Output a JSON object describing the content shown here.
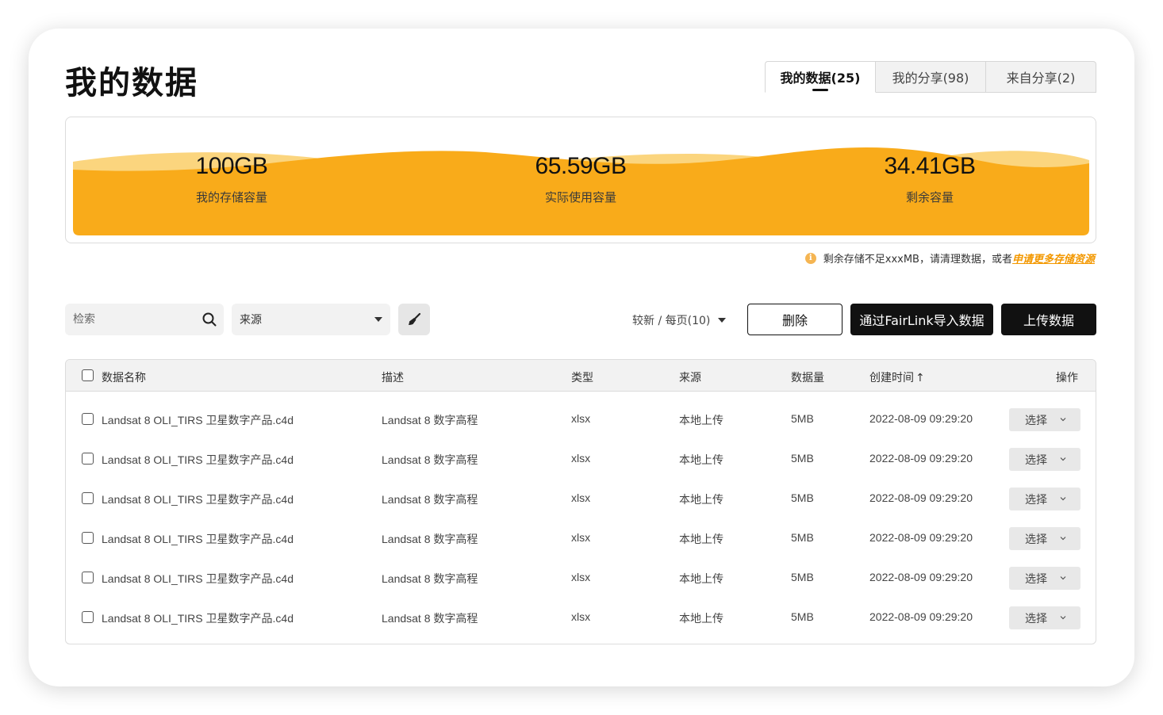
{
  "page_title": "我的数据",
  "tabs": [
    {
      "label": "我的数据(25)",
      "active": true
    },
    {
      "label": "我的分享(98)",
      "active": false
    },
    {
      "label": "来自分享(2)",
      "active": false
    }
  ],
  "storage": {
    "total": {
      "value": "100GB",
      "label": "我的存储容量"
    },
    "used": {
      "value": "65.59GB",
      "label": "实际使用容量"
    },
    "remaining": {
      "value": "34.41GB",
      "label": "剩余容量"
    },
    "colors": {
      "wave_main": "#f9ab1a",
      "wave_light": "#fbd57e"
    }
  },
  "notice": {
    "icon": "info-icon",
    "text": "剩余存储不足xxxMB，请清理数据，或者",
    "link": "申请更多存储资源"
  },
  "toolbar": {
    "search_placeholder": "检索",
    "source_select": "来源",
    "sort_label": "较新 / 每页(10)",
    "delete_label": "删除",
    "import_label": "通过FairLink导入数据",
    "upload_label": "上传数据"
  },
  "table": {
    "headers": {
      "name": "数据名称",
      "desc": "描述",
      "type": "类型",
      "source": "来源",
      "size": "数据量",
      "time": "创建时间",
      "op": "操作"
    },
    "op_select_label": "选择",
    "rows": [
      {
        "name": "Landsat 8 OLI_TIRS 卫星数字产品.c4d",
        "desc": "Landsat 8 数字高程",
        "type": "xlsx",
        "source": "本地上传",
        "size": "5MB",
        "time": "2022-08-09 09:29:20"
      },
      {
        "name": "Landsat 8 OLI_TIRS 卫星数字产品.c4d",
        "desc": "Landsat 8 数字高程",
        "type": "xlsx",
        "source": "本地上传",
        "size": "5MB",
        "time": "2022-08-09 09:29:20"
      },
      {
        "name": "Landsat 8 OLI_TIRS 卫星数字产品.c4d",
        "desc": "Landsat 8 数字高程",
        "type": "xlsx",
        "source": "本地上传",
        "size": "5MB",
        "time": "2022-08-09 09:29:20"
      },
      {
        "name": "Landsat 8 OLI_TIRS 卫星数字产品.c4d",
        "desc": "Landsat 8 数字高程",
        "type": "xlsx",
        "source": "本地上传",
        "size": "5MB",
        "time": "2022-08-09 09:29:20"
      },
      {
        "name": "Landsat 8 OLI_TIRS 卫星数字产品.c4d",
        "desc": "Landsat 8 数字高程",
        "type": "xlsx",
        "source": "本地上传",
        "size": "5MB",
        "time": "2022-08-09 09:29:20"
      },
      {
        "name": "Landsat 8 OLI_TIRS 卫星数字产品.c4d",
        "desc": "Landsat 8 数字高程",
        "type": "xlsx",
        "source": "本地上传",
        "size": "5MB",
        "time": "2022-08-09 09:29:20"
      }
    ]
  }
}
